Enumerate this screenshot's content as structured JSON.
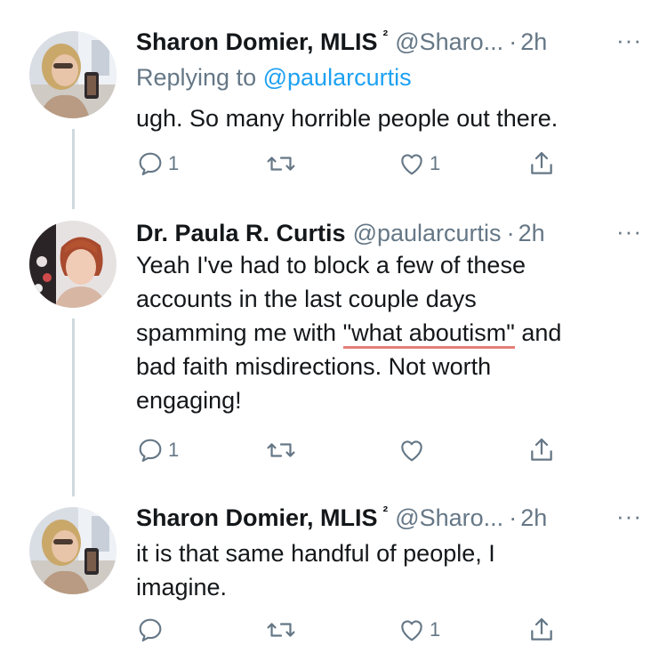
{
  "tweets": [
    {
      "name": "Sharon Domier, MLIS",
      "superscript": "²",
      "handle": "@Sharo...",
      "time": "2h",
      "more": "···",
      "replying_prefix": "Replying to",
      "replying_handle": "@paularcurtis",
      "text": "ugh. So many horrible people out there.",
      "reply_count": "1",
      "retweet_count": "",
      "like_count": "1"
    },
    {
      "name": "Dr. Paula R. Curtis",
      "handle": "@paularcurtis",
      "time": "2h",
      "more": "···",
      "text_line1": "Yeah I've had to block a few of these",
      "text_line2": "accounts in the last couple days",
      "text_line3_pre": "spamming me with ",
      "text_line3_hl": "\"what aboutism\"",
      "text_line3_post": " and",
      "text_line4": "bad faith misdirections. Not worth",
      "text_line5": "engaging!",
      "reply_count": "1",
      "retweet_count": "",
      "like_count": ""
    },
    {
      "name": "Sharon Domier, MLIS",
      "superscript": "²",
      "handle": "@Sharo...",
      "time": "2h",
      "more": "···",
      "text_line1": "it is that same handful of people, I",
      "text_line2": "imagine.",
      "reply_count": "",
      "retweet_count": "",
      "like_count": "1"
    }
  ],
  "colors": {
    "text": "#14171a",
    "secondary": "#657786",
    "link": "#1da1f2",
    "thread_line": "#cfd9de",
    "highlight_underline": "#e57f7a"
  },
  "icons": {
    "reply": "reply-icon",
    "retweet": "retweet-icon",
    "like": "heart-icon",
    "share": "share-icon",
    "more": "more-icon"
  }
}
